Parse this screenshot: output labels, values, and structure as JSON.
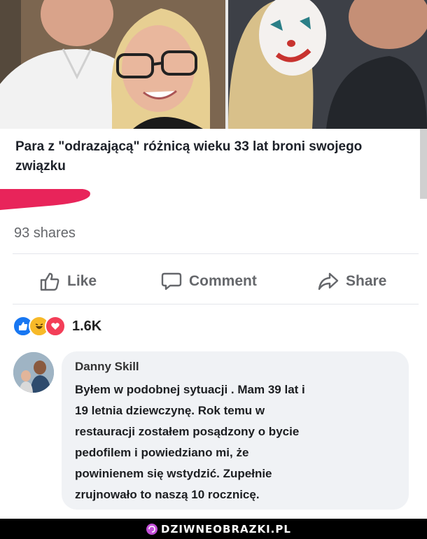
{
  "post": {
    "headline": "Para z \"odrazającą\" różnicą wieku 33 lat broni swojego związku",
    "shares": "93 shares"
  },
  "actions": {
    "like": "Like",
    "comment": "Comment",
    "share": "Share"
  },
  "reactions": {
    "icons": [
      "like-icon",
      "haha-icon",
      "love-icon"
    ],
    "count": "1.6K",
    "colors": {
      "like": "#1877f2",
      "haha": "#f7b928",
      "love": "#f33e58"
    }
  },
  "comment": {
    "author": "Danny Skill",
    "text": "Byłem w podobnej sytuacji . Mam 39 lat i\n19 letnia dziewczynę. Rok temu w\nrestauracji zostałem posądzony o bycie\npedofilem i powiedziano mi, że\npowinienem się wstydzić. Zupełnie\nzrujnowało to naszą 10 rocznicę."
  },
  "watermark": {
    "text": "DZIWNEOBRAZKI.PL",
    "icon": "brain-icon"
  },
  "colors": {
    "highlight": "#e8245a",
    "muted_text": "#65676b",
    "bubble": "#f0f2f5",
    "footer": "#000000"
  }
}
